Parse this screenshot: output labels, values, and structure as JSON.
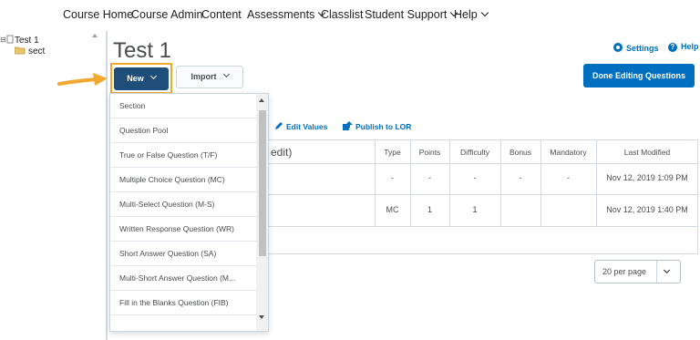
{
  "nav": {
    "items": [
      {
        "label": "Course Home"
      },
      {
        "label": "Course Admin"
      },
      {
        "label": "Content"
      },
      {
        "label": "Assessments"
      },
      {
        "label": "Classlist"
      },
      {
        "label": "Student Support"
      },
      {
        "label": "Help"
      }
    ]
  },
  "tree": {
    "root": "Test 1",
    "child": "sect"
  },
  "header": {
    "title": "Test 1",
    "settings_label": "Settings",
    "help_label": "Help"
  },
  "buttons": {
    "new_label": "New",
    "import_label": "Import",
    "done_label": "Done Editing Questions"
  },
  "toolbar": {
    "edit_values_label": "Edit Values",
    "publish_label": "Publish to LOR"
  },
  "grid": {
    "title_fragment": "edit)",
    "columns": [
      "Type",
      "Points",
      "Difficulty",
      "Bonus",
      "Mandatory",
      "Last Modified"
    ],
    "rows": [
      [
        "-",
        "-",
        "-",
        "-",
        "-",
        "Nov 12, 2019 1:09 PM"
      ],
      [
        "MC",
        "1",
        "1",
        "",
        "",
        "Nov 12, 2019 1:40 PM"
      ]
    ]
  },
  "pagination": {
    "per_page": "20 per page"
  },
  "menu": {
    "items": [
      "Section",
      "Question Pool",
      "True or False Question (T/F)",
      "Multiple Choice Question (MC)",
      "Multi-Select Question (M-S)",
      "Written Response Question (WR)",
      "Short Answer Question (SA)",
      "Multi-Short Answer Question (M...",
      "Fill in the Blanks Question (FIB)"
    ]
  },
  "colors": {
    "primary": "#006fbf",
    "new_button": "#1e4e79",
    "highlight_border": "#f0a830",
    "arrow": "#f0a830"
  }
}
